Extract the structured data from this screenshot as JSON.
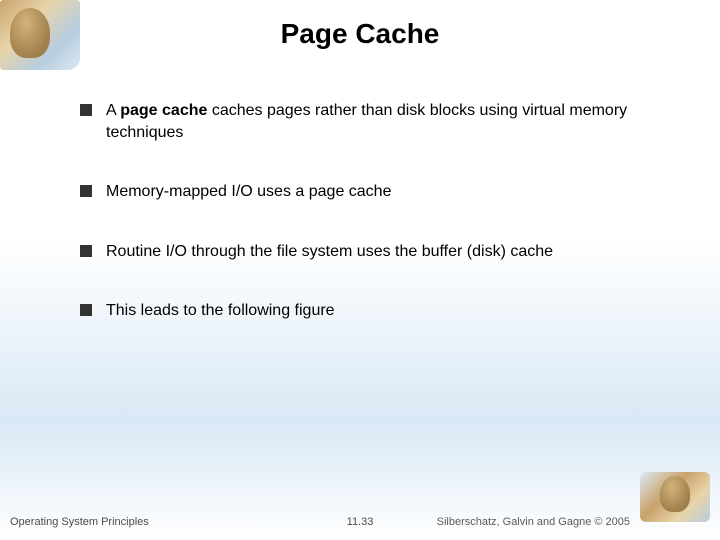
{
  "title": "Page Cache",
  "bullets": [
    {
      "prefix": "A ",
      "bold": "page cache",
      "rest": " caches pages rather than disk blocks using virtual memory techniques"
    },
    {
      "prefix": "",
      "bold": "",
      "rest": "Memory-mapped I/O uses a page cache"
    },
    {
      "prefix": "",
      "bold": "",
      "rest": "Routine I/O through the file system uses the buffer (disk) cache"
    },
    {
      "prefix": "",
      "bold": "",
      "rest": "This leads to the following figure"
    }
  ],
  "footer": {
    "left": "Operating System Principles",
    "center": "11.33",
    "right": "Silberschatz, Galvin and Gagne © 2005"
  }
}
